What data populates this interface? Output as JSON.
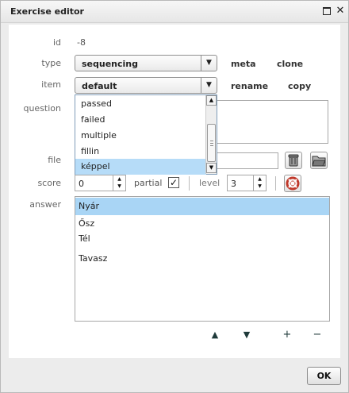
{
  "window": {
    "title": "Exercise editor",
    "maximize_icon": "maximize-icon",
    "close_glyph": "✕"
  },
  "form": {
    "id_label": "id",
    "id_value": "-8",
    "type_label": "type",
    "type_value": "sequencing",
    "type_links": [
      "meta",
      "clone"
    ],
    "item_label": "item",
    "item_value": "default",
    "item_links": [
      "rename",
      "copy"
    ],
    "question_label": "question",
    "file_label": "file",
    "score_label": "score",
    "score_value": "0",
    "partial_label": "partial",
    "partial_checked": true,
    "level_label": "level",
    "level_value": "3",
    "answer_label": "answer"
  },
  "item_dropdown": {
    "options": [
      "passed",
      "failed",
      "multiple",
      "fillin",
      "képpel"
    ],
    "highlighted": "képpel"
  },
  "answers": {
    "items": [
      "Nyár",
      "Ősz",
      "Tél",
      "Tavasz"
    ],
    "selected": "Nyár"
  },
  "actions": {
    "up_glyph": "▲",
    "down_glyph": "▼",
    "add_glyph": "+",
    "remove_glyph": "−"
  },
  "footer": {
    "ok_label": "OK"
  },
  "colors": {
    "selection": "#a9d5f5",
    "panel_bg": "#ffffff",
    "dialog_bg": "#ececec"
  }
}
